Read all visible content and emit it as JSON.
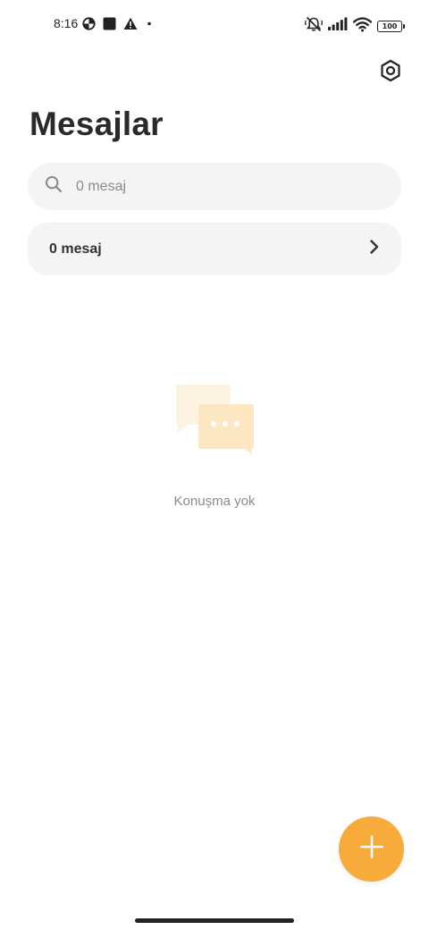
{
  "status_bar": {
    "time": "8:16",
    "battery": "100",
    "left_icons": [
      "data-saver-icon",
      "square-notification-icon",
      "warning-icon",
      "dot-icon"
    ],
    "right_icons": [
      "vibrate-off-icon",
      "signal-icon",
      "wifi-icon",
      "battery-icon"
    ]
  },
  "header": {
    "title": "Mesajlar",
    "settings_icon": "settings-icon"
  },
  "search": {
    "placeholder": "0 mesaj",
    "value": ""
  },
  "messages_row": {
    "label": "0 mesaj"
  },
  "empty_state": {
    "text": "Konuşma yok"
  },
  "fab": {
    "icon": "plus-icon",
    "color": "#f7ab3b"
  },
  "colors": {
    "accent": "#f7ab3b",
    "surface": "#f4f4f4",
    "illustration_light": "#fdf3e1",
    "illustration_dark": "#fde7c2"
  }
}
